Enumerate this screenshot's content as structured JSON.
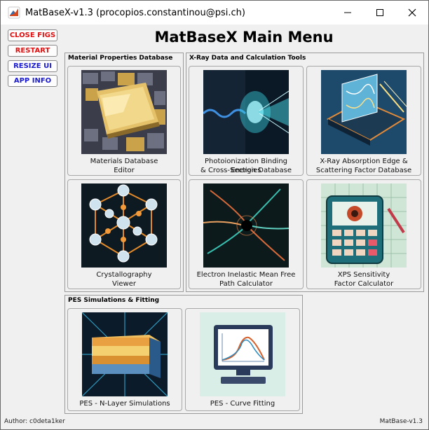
{
  "window": {
    "title": "MatBaseX-v1.3 (procopios.constantinou@psi.ch)"
  },
  "sidebar": {
    "buttons": [
      {
        "label": "CLOSE FIGS",
        "color": "#e01010"
      },
      {
        "label": "RESTART",
        "color": "#e01010"
      },
      {
        "label": "RESIZE UI",
        "color": "#1a1ad0"
      },
      {
        "label": "APP INFO",
        "color": "#1a1ad0"
      }
    ]
  },
  "main": {
    "title": "MatBaseX Main Menu"
  },
  "panels": {
    "materials": {
      "title": "Material Properties Database"
    },
    "xray": {
      "title": "X-Ray Data and Calculation Tools"
    },
    "pes": {
      "title": "PES Simulations & Fitting"
    }
  },
  "cards": {
    "materials_editor": {
      "line1": "Materials Database",
      "line2": "Editor"
    },
    "photoionization": {
      "line1": "Photoionization Binding Energies",
      "line2": "& Cross-Section Database"
    },
    "xray_absorption": {
      "line1": "X-Ray Absorption Edge &",
      "line2": "Scattering Factor Database"
    },
    "crystallography": {
      "line1": "Crystallography",
      "line2": "Viewer"
    },
    "imfp": {
      "line1": "Electron Inelastic Mean Free",
      "line2": "Path Calculator"
    },
    "xps_sensitivity": {
      "line1": "XPS Sensitivity",
      "line2": "Factor Calculator"
    },
    "pes_nlayer": {
      "line1": "PES - N-Layer Simulations"
    },
    "pes_fitting": {
      "line1": "PES - Curve Fitting"
    }
  },
  "footer": {
    "author": "Author: c0deta1ker",
    "version": "MatBase-v1.3"
  }
}
